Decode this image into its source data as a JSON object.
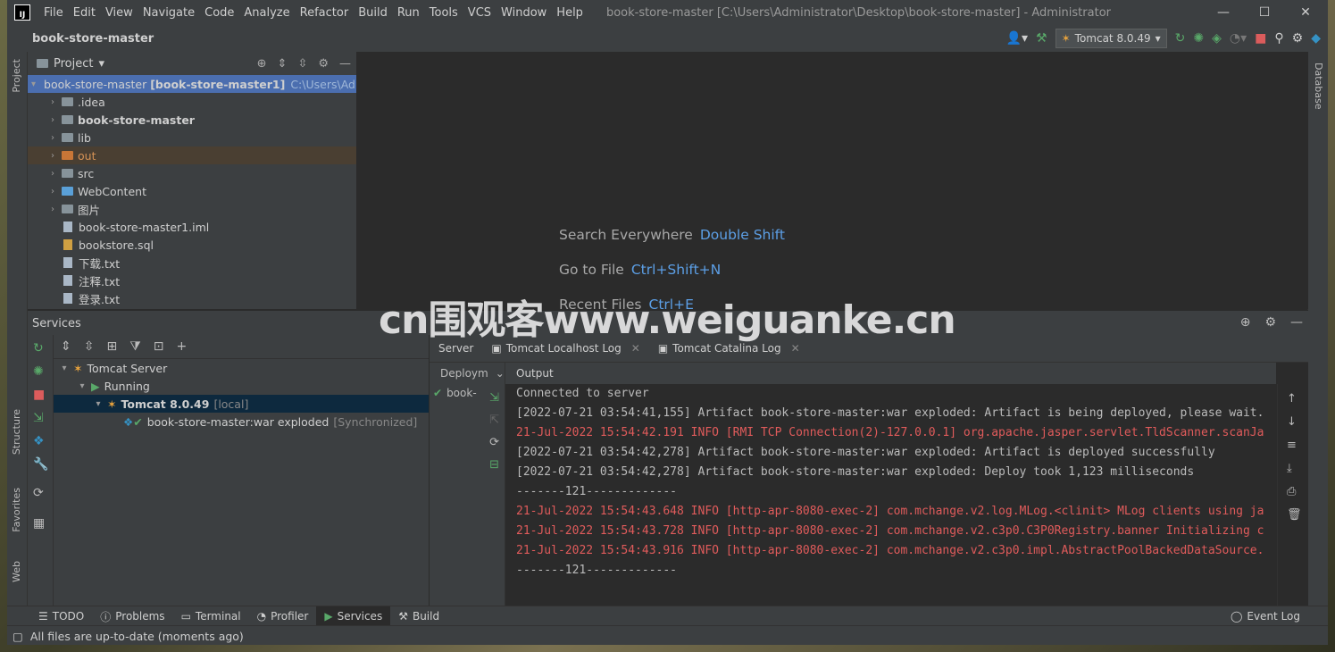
{
  "window": {
    "title": "book-store-master [C:\\Users\\Administrator\\Desktop\\book-store-master] - Administrator",
    "menu": [
      "File",
      "Edit",
      "View",
      "Navigate",
      "Code",
      "Analyze",
      "Refactor",
      "Build",
      "Run",
      "Tools",
      "VCS",
      "Window",
      "Help"
    ]
  },
  "navbar": {
    "breadcrumb": "book-store-master",
    "run_config": "Tomcat 8.0.49"
  },
  "left_strip": {
    "project": "Project",
    "structure": "Structure",
    "favorites": "Favorites",
    "web": "Web"
  },
  "right_strip": {
    "database": "Database"
  },
  "project": {
    "title": "Project",
    "root": {
      "name": "book-store-master",
      "module": "[book-store-master1]",
      "path": "C:\\Users\\Administrator\\Desktop\\book-store-master"
    },
    "items": [
      {
        "label": ".idea",
        "type": "folder"
      },
      {
        "label": "book-store-master",
        "type": "folder"
      },
      {
        "label": "lib",
        "type": "folder"
      },
      {
        "label": "out",
        "type": "folder-orange"
      },
      {
        "label": "src",
        "type": "folder"
      },
      {
        "label": "WebContent",
        "type": "folder-web"
      },
      {
        "label": "图片",
        "type": "folder"
      },
      {
        "label": "book-store-master1.iml",
        "type": "file"
      },
      {
        "label": "bookstore.sql",
        "type": "file"
      },
      {
        "label": "下载.txt",
        "type": "file"
      },
      {
        "label": "注释.txt",
        "type": "file"
      },
      {
        "label": "登录.txt",
        "type": "file"
      }
    ]
  },
  "editor": {
    "hints": [
      {
        "label": "Search Everywhere",
        "key": "Double Shift"
      },
      {
        "label": "Go to File",
        "key": "Ctrl+Shift+N"
      },
      {
        "label": "Recent Files",
        "key": "Ctrl+E"
      }
    ]
  },
  "services": {
    "title": "Services",
    "tree": {
      "server": "Tomcat Server",
      "running": "Running",
      "tomcat": "Tomcat 8.0.49",
      "tomcat_tag": "[local]",
      "artifact": "book-store-master:war exploded",
      "artifact_tag": "[Synchronized]"
    },
    "tabs": [
      "Server",
      "Tomcat Localhost Log",
      "Tomcat Catalina Log"
    ],
    "deployment": {
      "header": "Deploym",
      "item": "book-"
    },
    "output": {
      "header": "Output",
      "lines": [
        {
          "text": "Connected to server",
          "style": "w"
        },
        {
          "text": "[2022-07-21 03:54:41,155] Artifact book-store-master:war exploded: Artifact is being deployed, please wait.",
          "style": "w"
        },
        {
          "text": "21-Jul-2022 15:54:42.191 INFO [RMI TCP Connection(2)-127.0.0.1] org.apache.jasper.servlet.TldScanner.scanJa",
          "style": "r"
        },
        {
          "text": "[2022-07-21 03:54:42,278] Artifact book-store-master:war exploded: Artifact is deployed successfully",
          "style": "w"
        },
        {
          "text": "[2022-07-21 03:54:42,278] Artifact book-store-master:war exploded: Deploy took 1,123 milliseconds",
          "style": "w"
        },
        {
          "text": "-------121-------------",
          "style": "w"
        },
        {
          "text": "21-Jul-2022 15:54:43.648 INFO [http-apr-8080-exec-2] com.mchange.v2.log.MLog.<clinit> MLog clients using ja",
          "style": "r"
        },
        {
          "text": "21-Jul-2022 15:54:43.728 INFO [http-apr-8080-exec-2] com.mchange.v2.c3p0.C3P0Registry.banner Initializing c",
          "style": "r"
        },
        {
          "text": "21-Jul-2022 15:54:43.916 INFO [http-apr-8080-exec-2] com.mchange.v2.c3p0.impl.AbstractPoolBackedDataSource.",
          "style": "r"
        },
        {
          "text": "-------121-------------",
          "style": "w"
        }
      ]
    }
  },
  "bottom_tabs": [
    "TODO",
    "Problems",
    "Terminal",
    "Profiler",
    "Services",
    "Build"
  ],
  "event_log": "Event Log",
  "status": "All files are up-to-date (moments ago)",
  "watermark": "cn围观客www.weiguanke.cn"
}
